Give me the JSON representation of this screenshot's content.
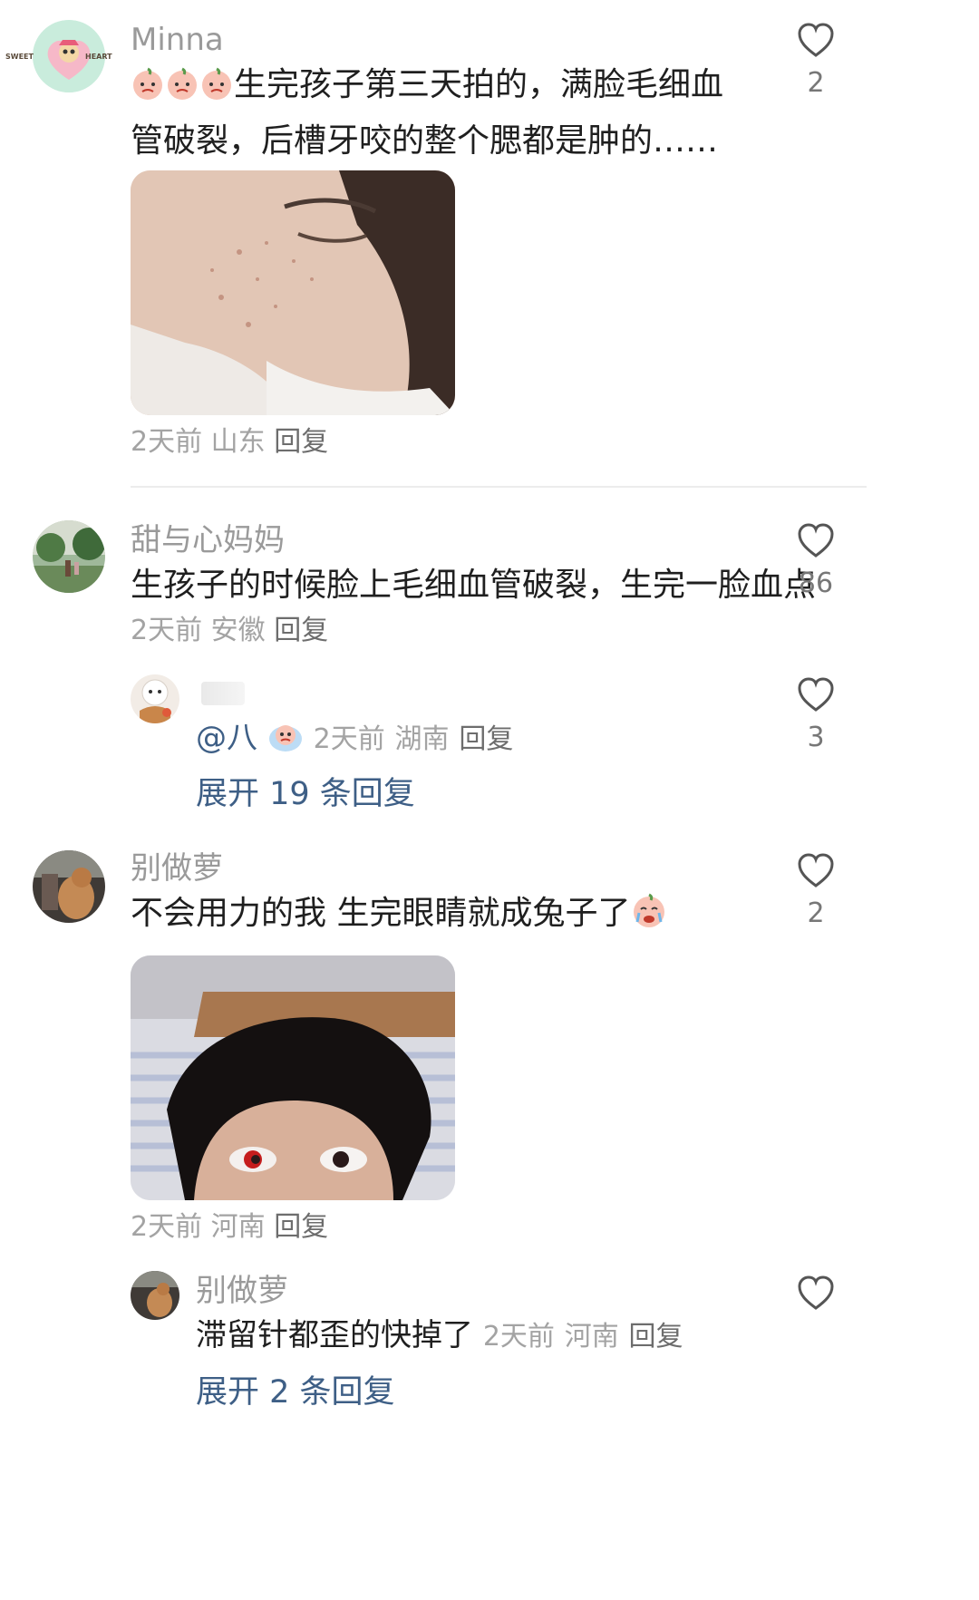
{
  "comments": [
    {
      "username": "Minna",
      "text": "生完孩子第三天拍的，满脸毛细血管破裂，后槽牙咬的整个腮都是肿的……",
      "time": "2天前",
      "location": "山东",
      "reply_label": "回复",
      "likes": "2",
      "avatar_badge": [
        "SWEET",
        "HEART"
      ]
    },
    {
      "username": "甜与心妈妈",
      "text": "生孩子的时候脸上毛细血管破裂，生完一脸血点",
      "time": "2天前",
      "location": "安徽",
      "reply_label": "回复",
      "likes": "86",
      "sub_reply": {
        "text": "@八",
        "time": "2天前",
        "location": "湖南",
        "reply_label": "回复",
        "likes": "3"
      },
      "expand_label": "展开 19 条回复"
    },
    {
      "username": "别做萝",
      "text": "不会用力的我 生完眼睛就成兔子了",
      "time": "2天前",
      "location": "河南",
      "reply_label": "回复",
      "likes": "2",
      "sub_reply": {
        "username": "别做萝",
        "text": "滞留针都歪的快掉了",
        "time": "2天前",
        "location": "河南",
        "reply_label": "回复"
      },
      "expand_label": "展开 2 条回复"
    }
  ],
  "icons": {
    "like": "heart-outline-icon",
    "emoji": "crying-face-emoji"
  },
  "colors": {
    "link": "#3e5f86",
    "muted": "#a3a3a3",
    "text": "#1f1f1f"
  }
}
